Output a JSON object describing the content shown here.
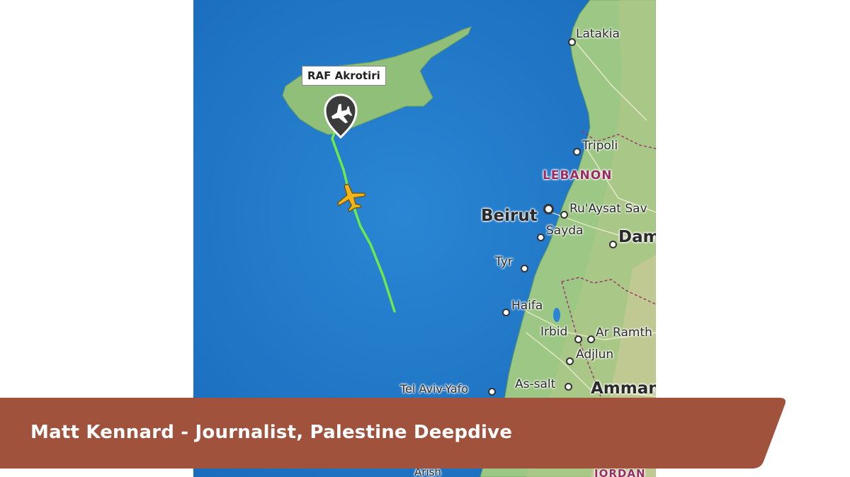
{
  "map": {
    "airport_label": "RAF Akrotiri",
    "places": {
      "latakia": "Latakia",
      "tripoli": "Tripoli",
      "lebanon": "LEBANON",
      "beirut": "Beirut",
      "ruaysat": "Ru'Aysat Sav",
      "sayda": "Sayda",
      "damascus": "Dam",
      "tyr": "Tyr",
      "haifa": "Haifa",
      "irbid": "Irbid",
      "ar_ramtha": "Ar Ramth",
      "adjlun": "Adjlun",
      "tel_aviv": "Tel Aviv-Yafo",
      "as_salt": "As-salt",
      "amman": "Amman",
      "arish": "Arish",
      "jordan": "JORDAN"
    },
    "colors": {
      "sea": "#1f78c8",
      "land": "#8fbf78",
      "flight_path": "#6fe84a",
      "aircraft": "#f2b418"
    }
  },
  "lower_third": {
    "caption": "Matt Kennard - Journalist, Palestine Deepdive",
    "color": "#a0523d"
  }
}
